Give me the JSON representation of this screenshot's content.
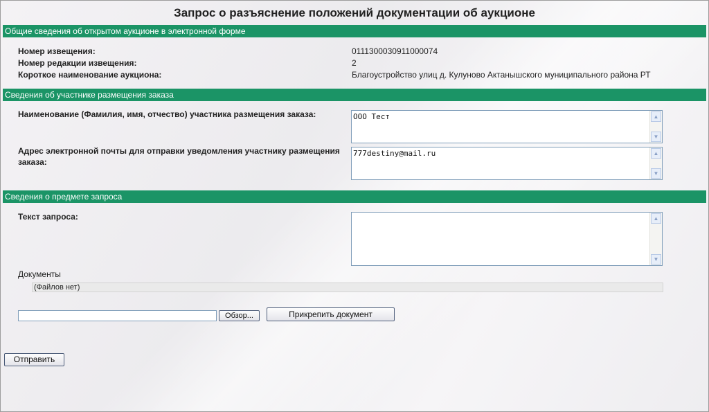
{
  "title": "Запрос о разъяснение положений документации об аукционе",
  "sections": {
    "general": "Общие сведения об открытом аукционе в электронной форме",
    "participant": "Сведения об участнике размещения заказа",
    "subject": "Сведения о предмете запроса"
  },
  "general": {
    "notice_number_label": "Номер извещения:",
    "notice_number_value": "0111300030911000074",
    "revision_label": "Номер редакции извещения:",
    "revision_value": "2",
    "short_name_label": "Короткое наименование аукциона:",
    "short_name_value": "Благоустройство улиц д. Кулуново Актанышского муниципального района РТ"
  },
  "participant": {
    "name_label": "Наименование (Фамилия, имя, отчество) участника размещения заказа:",
    "name_value": "ООО Тест",
    "email_label_line1": "Адрес электронной почты для отправки уведомления участнику размещения",
    "email_label_line2": "заказа:",
    "email_value": "777destiny@mail.ru"
  },
  "subject": {
    "request_text_label": "Текст запроса:",
    "request_text_value": "",
    "documents_label": "Документы",
    "no_files_text": "(Файлов нет)",
    "browse_label": "Обзор...",
    "attach_label": "Прикрепить документ"
  },
  "submit_label": "Отправить",
  "colors": {
    "section_header": "#1b9466",
    "input_border": "#7f9db9"
  }
}
